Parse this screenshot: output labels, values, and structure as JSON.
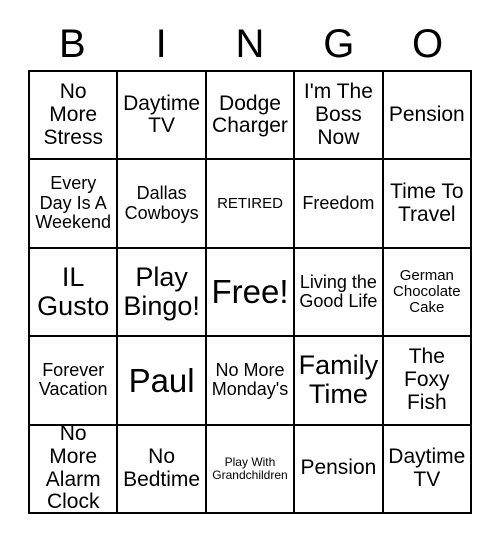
{
  "header": {
    "letters": [
      "B",
      "I",
      "N",
      "G",
      "O"
    ]
  },
  "grid": {
    "rows": 5,
    "columns": 5,
    "border_color": "#000000",
    "background_color": "#ffffff",
    "text_color": "#000000",
    "cells": [
      [
        {
          "text": "No More Stress",
          "size": "md"
        },
        {
          "text": "Daytime TV",
          "size": "md"
        },
        {
          "text": "Dodge Charger",
          "size": "md"
        },
        {
          "text": "I'm The Boss Now",
          "size": "md"
        },
        {
          "text": "Pension",
          "size": "md"
        }
      ],
      [
        {
          "text": "Every Day Is A Weekend",
          "size": "sm"
        },
        {
          "text": "Dallas Cowboys",
          "size": "sm"
        },
        {
          "text": "RETIRED",
          "size": "xs"
        },
        {
          "text": "Freedom",
          "size": "sm"
        },
        {
          "text": "Time To Travel",
          "size": "md"
        }
      ],
      [
        {
          "text": "IL Gusto",
          "size": "lg"
        },
        {
          "text": "Play Bingo!",
          "size": "lg"
        },
        {
          "text": "Free!",
          "size": "xl"
        },
        {
          "text": "Living the Good Life",
          "size": "sm"
        },
        {
          "text": "German Chocolate Cake",
          "size": "xs"
        }
      ],
      [
        {
          "text": "Forever Vacation",
          "size": "sm"
        },
        {
          "text": "Paul",
          "size": "xl"
        },
        {
          "text": "No More Monday's",
          "size": "sm"
        },
        {
          "text": "Family Time",
          "size": "lg"
        },
        {
          "text": "The Foxy Fish",
          "size": "md"
        }
      ],
      [
        {
          "text": "No More Alarm Clock",
          "size": "md"
        },
        {
          "text": "No Bedtime",
          "size": "md"
        },
        {
          "text": "Play With Grandchildren",
          "size": "xxs"
        },
        {
          "text": "Pension",
          "size": "md"
        },
        {
          "text": "Daytime TV",
          "size": "md"
        }
      ]
    ]
  }
}
